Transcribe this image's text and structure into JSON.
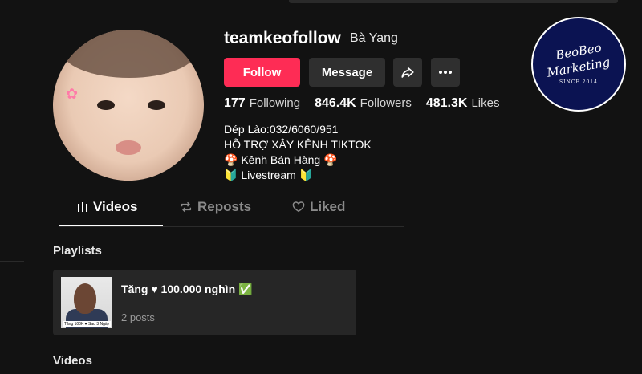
{
  "profile": {
    "username": "teamkeofollow",
    "nickname": "Bà Yang",
    "follow_label": "Follow",
    "message_label": "Message"
  },
  "stats": {
    "following_count": "177",
    "following_label": "Following",
    "followers_count": "846.4K",
    "followers_label": "Followers",
    "likes_count": "481.3K",
    "likes_label": "Likes"
  },
  "bio": {
    "line1": "Dép Lào:032/6060/951",
    "line2": "HỖ TRỢ XÂY KÊNH TIKTOK",
    "line3": "🍄 Kênh Bán Hàng 🍄",
    "line4": "🔰 Livestream 🔰"
  },
  "tabs": {
    "videos": "Videos",
    "reposts": "Reposts",
    "liked": "Liked"
  },
  "playlists": {
    "title": "Playlists",
    "items": [
      {
        "title": "Tăng ♥ 100.000 nghìn ✅",
        "count": "2 posts",
        "thumb_caption": "Tăng 100K ♥ Sau 3 Ngày"
      }
    ]
  },
  "videos_section": {
    "title": "Videos"
  },
  "watermark": {
    "line1": "BeoBeo",
    "line2": "Marketing",
    "line3": "SINCE 2014"
  },
  "colors": {
    "background": "#121212",
    "follow_button": "#fe2c55",
    "secondary_button": "#2f2f2f",
    "card": "#262626",
    "logo_bg": "#0b1352"
  },
  "icons": {
    "share": "share-arrow-icon",
    "more": "ellipsis-icon",
    "videos_tab": "grid-bars-icon",
    "reposts_tab": "repost-icon",
    "liked_tab": "heart-icon"
  }
}
